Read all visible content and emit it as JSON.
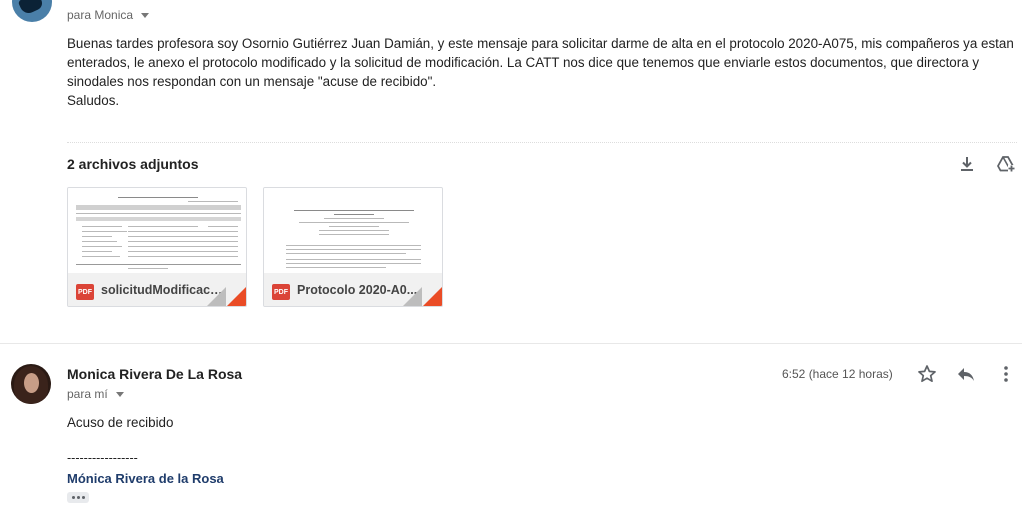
{
  "message1": {
    "recipient_label": "para Monica",
    "body": "Buenas tardes profesora soy Osornio Gutiérrez Juan Damián, y este mensaje para solicitar darme de alta en el protocolo 2020-A075, mis compañeros ya estan enterados, le anexo el protocolo modificado y la solicitud de modificación. La CATT nos dice que tenemos que enviarle estos documentos, que directora y sinodales nos respondan con un mensaje \"acuse de recibido\".\nSaludos."
  },
  "attachments": {
    "title": "2 archivos adjuntos",
    "items": [
      {
        "type_label": "PDF",
        "name": "solicitudModificaci..."
      },
      {
        "type_label": "PDF",
        "name": "Protocolo 2020-A0..."
      }
    ]
  },
  "message2": {
    "sender": "Monica Rivera De La Rosa",
    "recipient_label": "para mí",
    "time": "6:52 (hace 12 horas)",
    "body": "Acuso de recibido",
    "signature_dashes": "-----------------",
    "signature_name": "Mónica Rivera de la Rosa"
  },
  "icons": {
    "download_all": "download-icon",
    "save_drive": "drive-add-icon",
    "star": "star-icon",
    "reply": "reply-icon",
    "more": "more-vert-icon"
  },
  "colors": {
    "pdf_red": "#db4437",
    "corner_orange": "#ea4c26",
    "signature_blue": "#1f3c6b"
  }
}
